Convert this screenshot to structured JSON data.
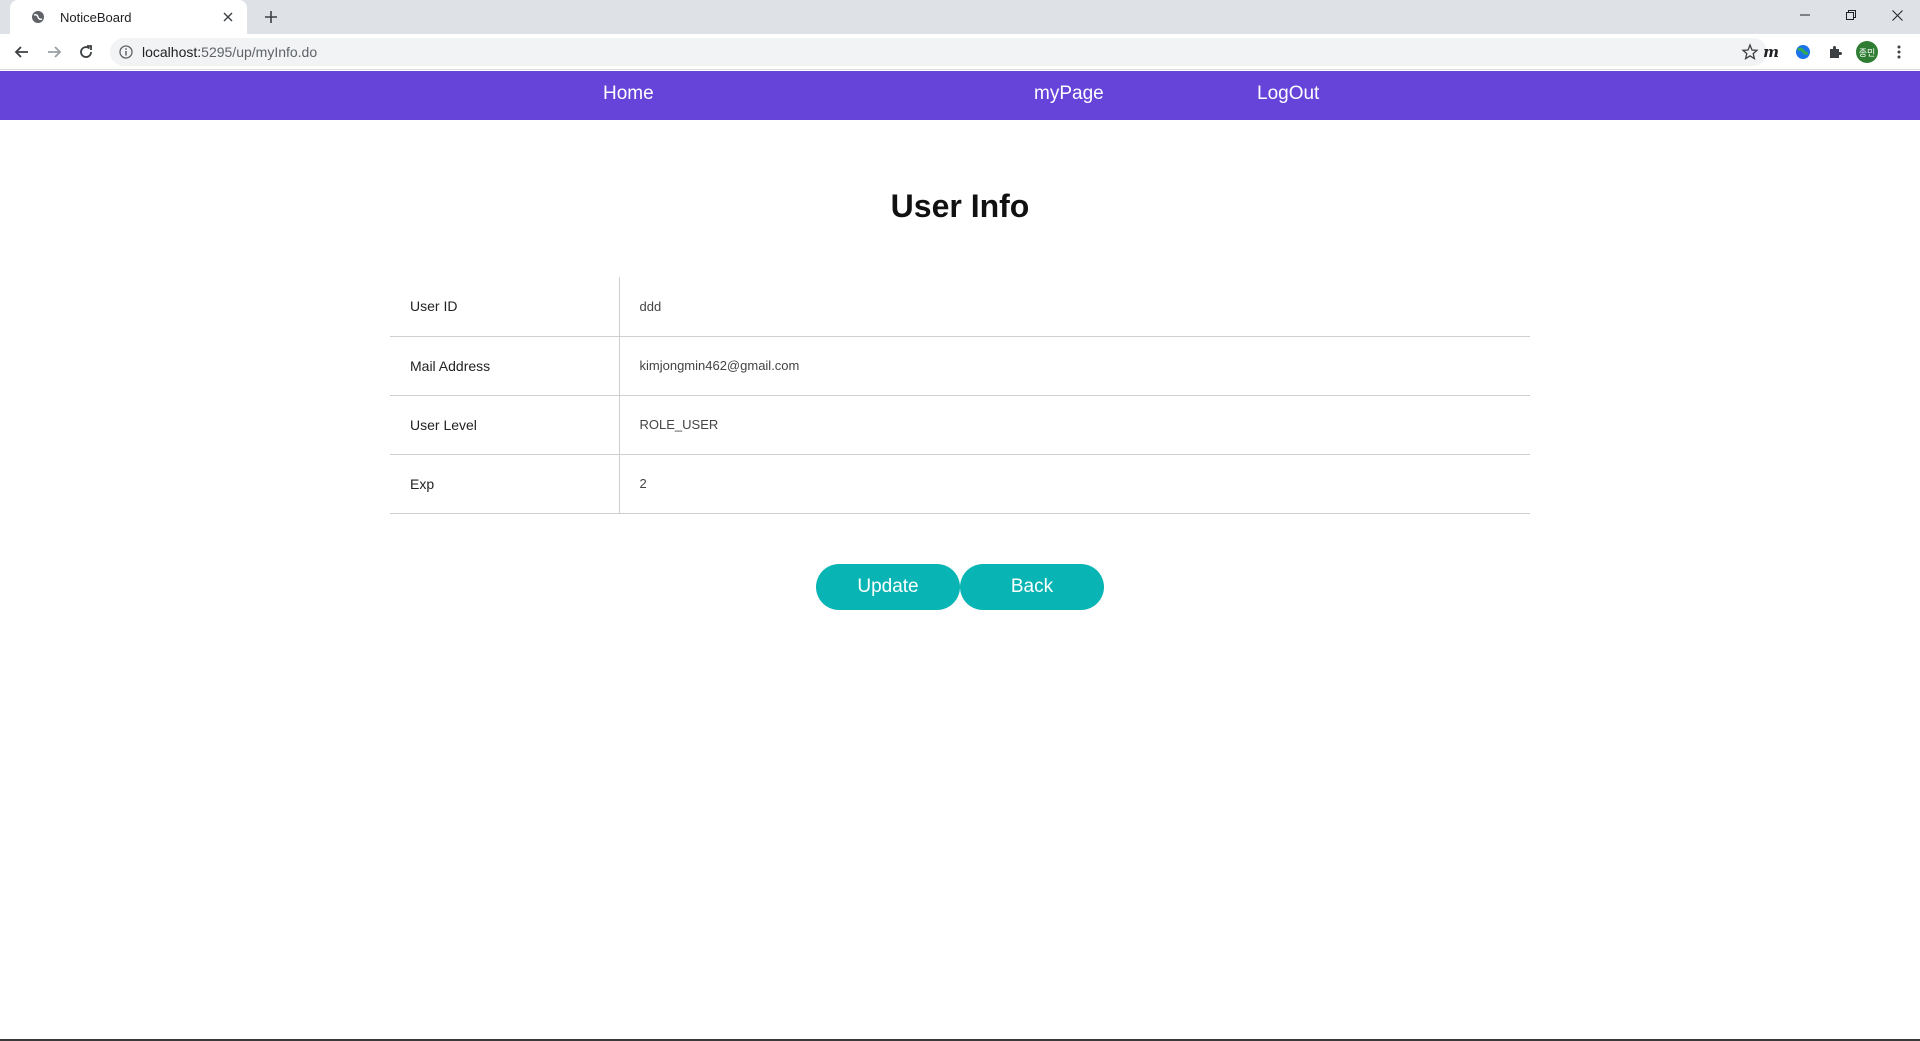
{
  "browser": {
    "tab_title": "NoticeBoard",
    "url_host": "localhost:",
    "url_path": "5295/up/myInfo.do",
    "avatar_text": "종민"
  },
  "nav": {
    "home": "Home",
    "mypage": "myPage",
    "logout": "LogOut"
  },
  "page": {
    "title": "User Info",
    "rows": [
      {
        "label": "User ID",
        "value": "ddd"
      },
      {
        "label": "Mail Address",
        "value": "kimjongmin462@gmail.com"
      },
      {
        "label": "User Level",
        "value": "ROLE_USER"
      },
      {
        "label": "Exp",
        "value": "2"
      }
    ],
    "update_label": "Update",
    "back_label": "Back"
  },
  "colors": {
    "navbar": "#6643d9",
    "button": "#09b5b4"
  }
}
